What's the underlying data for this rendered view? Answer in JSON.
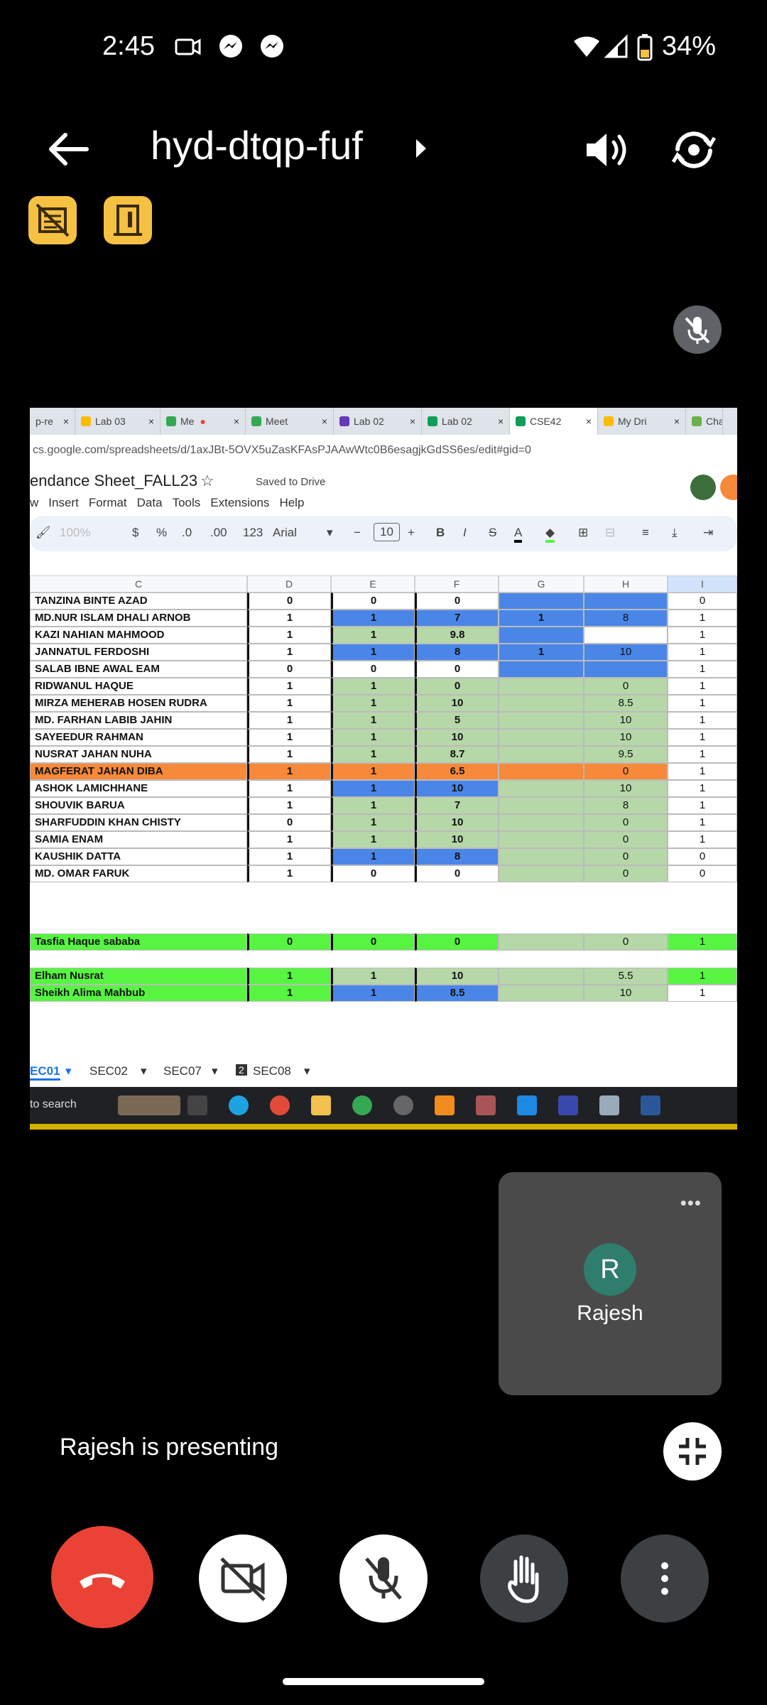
{
  "status_bar": {
    "time": "2:45",
    "battery": "34%"
  },
  "meeting": {
    "code": "hyd-dtqp-fuf",
    "presenting_text": "Rajesh is presenting"
  },
  "self_tile": {
    "initial": "R",
    "name": "Rajesh"
  },
  "browser": {
    "tabs": [
      "p-re",
      "Lab 03",
      "Me",
      "Meet",
      "Lab 02",
      "Lab 02",
      "CSE42",
      "My Dri",
      "Cha"
    ],
    "url": "cs.google.com/spreadsheets/d/1axJBt-5OVX5uZasKFAsPJAAwWtc0B6esagjkGdSS6es/edit#gid=0"
  },
  "sheet": {
    "title": "endance Sheet_FALL23",
    "saved": "Saved to Drive",
    "menus": [
      "w",
      "Insert",
      "Format",
      "Data",
      "Tools",
      "Extensions",
      "Help"
    ],
    "toolbar": {
      "zoom": "100%",
      "currency": "$",
      "percent": "%",
      "dec_less": ".0",
      "dec_more": ".00",
      "num_format": "123",
      "font": "Arial",
      "size": "10"
    },
    "col_headers": [
      "C",
      "D",
      "E",
      "F",
      "G",
      "H",
      "I"
    ],
    "rows": [
      {
        "c": "TANZINA BINTE AZAD",
        "d": "0",
        "e": "0",
        "f": "0",
        "g": "",
        "h": "",
        "i": "0"
      },
      {
        "c": "MD.NUR ISLAM DHALI ARNOB",
        "d": "1",
        "e": "1",
        "f": "7",
        "g": "1",
        "h": "8",
        "i": "1"
      },
      {
        "c": "KAZI NAHIAN MAHMOOD",
        "d": "1",
        "e": "1",
        "f": "9.8",
        "g": "",
        "h": "",
        "i": "1"
      },
      {
        "c": "JANNATUL FERDOSHI",
        "d": "1",
        "e": "1",
        "f": "8",
        "g": "1",
        "h": "10",
        "i": "1"
      },
      {
        "c": "SALAB IBNE AWAL EAM",
        "d": "0",
        "e": "0",
        "f": "0",
        "g": "",
        "h": "",
        "i": "1"
      },
      {
        "c": "RIDWANUL HAQUE",
        "d": "1",
        "e": "1",
        "f": "0",
        "g": "",
        "h": "0",
        "i": "1"
      },
      {
        "c": "MIRZA MEHERAB HOSEN RUDRA",
        "d": "1",
        "e": "1",
        "f": "10",
        "g": "",
        "h": "8.5",
        "i": "1"
      },
      {
        "c": "MD. FARHAN LABIB JAHIN",
        "d": "1",
        "e": "1",
        "f": "5",
        "g": "",
        "h": "10",
        "i": "1"
      },
      {
        "c": "SAYEEDUR RAHMAN",
        "d": "1",
        "e": "1",
        "f": "10",
        "g": "",
        "h": "10",
        "i": "1"
      },
      {
        "c": "NUSRAT JAHAN NUHA",
        "d": "1",
        "e": "1",
        "f": "8.7",
        "g": "",
        "h": "9.5",
        "i": "1"
      },
      {
        "c": "MAGFERAT JAHAN DIBA",
        "d": "1",
        "e": "1",
        "f": "6.5",
        "g": "",
        "h": "0",
        "i": "1"
      },
      {
        "c": "ASHOK LAMICHHANE",
        "d": "1",
        "e": "1",
        "f": "10",
        "g": "",
        "h": "10",
        "i": "1"
      },
      {
        "c": "SHOUVIK BARUA",
        "d": "1",
        "e": "1",
        "f": "7",
        "g": "",
        "h": "8",
        "i": "1"
      },
      {
        "c": "SHARFUDDIN KHAN CHISTY",
        "d": "0",
        "e": "1",
        "f": "10",
        "g": "",
        "h": "0",
        "i": "1"
      },
      {
        "c": "SAMIA ENAM",
        "d": "1",
        "e": "1",
        "f": "10",
        "g": "",
        "h": "0",
        "i": "1"
      },
      {
        "c": "KAUSHIK DATTA",
        "d": "1",
        "e": "1",
        "f": "8",
        "g": "",
        "h": "0",
        "i": "0"
      },
      {
        "c": "MD. OMAR FARUK",
        "d": "1",
        "e": "0",
        "f": "0",
        "g": "",
        "h": "0",
        "i": "0"
      }
    ],
    "extra_rows": [
      {
        "c": "Tasfia Haque sababa",
        "d": "0",
        "e": "0",
        "f": "0",
        "g": "",
        "h": "0",
        "i": "1"
      },
      {
        "c": "Elham Nusrat",
        "d": "1",
        "e": "1",
        "f": "10",
        "g": "",
        "h": "5.5",
        "i": "1"
      },
      {
        "c": "Sheikh Alima Mahbub",
        "d": "1",
        "e": "1",
        "f": "8.5",
        "g": "",
        "h": "10",
        "i": "1"
      }
    ],
    "sheet_tabs": [
      "EC01",
      "SEC02",
      "SEC07",
      "SEC08"
    ],
    "sheet_tab_badge": "2",
    "taskbar_search": "to search"
  },
  "colors": {
    "accent_yellow": "#f6c043",
    "end_call": "#ea4335",
    "green": "#b6d7a8",
    "blue": "#4a86e8",
    "orange": "#f6893a",
    "lime": "#57f542"
  }
}
